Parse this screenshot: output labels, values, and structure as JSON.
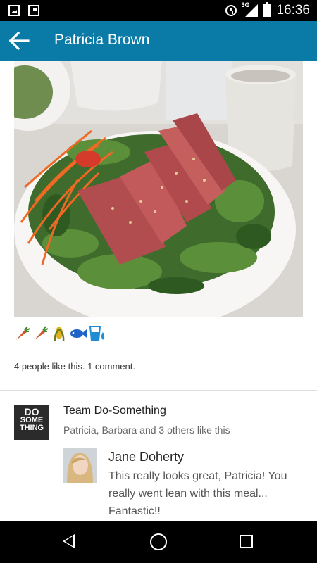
{
  "status_bar": {
    "time": "16:36",
    "network": "3G"
  },
  "app_bar": {
    "title": "Patricia Brown"
  },
  "post": {
    "food_icons": [
      "carrot-icon",
      "carrot-icon",
      "corn-icon",
      "fish-icon",
      "water-icon"
    ],
    "likes_summary": "4 people like this. 1 comment."
  },
  "team": {
    "avatar_text_1": "DO",
    "avatar_text_2": "SOME",
    "avatar_text_3": "THING",
    "name": "Team Do-Something",
    "likes": "Patricia, Barbara and 3 others like this"
  },
  "comment": {
    "author": "Jane Doherty",
    "text": "This really looks great, Patricia! You really went lean with this meal... Fantastic!!"
  },
  "colors": {
    "app_bar": "#0a7aa7",
    "carrot": "#d2542a",
    "fish": "#1e64c8",
    "water": "#1e8cd2"
  }
}
